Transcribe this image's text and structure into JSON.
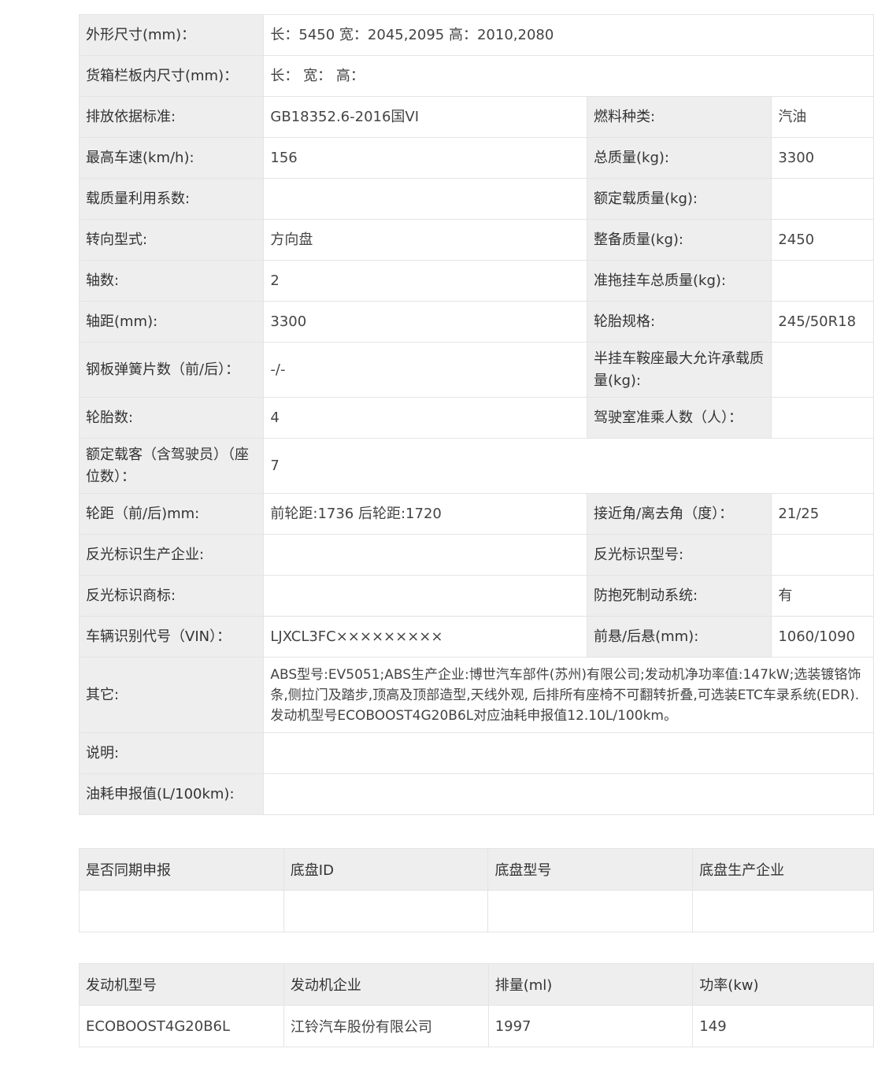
{
  "spec": {
    "dimensions": {
      "label": "外形尺寸(mm)：",
      "value": "长：5450 宽：2045,2095 高：2010,2080"
    },
    "cargo_box": {
      "label": "货箱栏板内尺寸(mm)：",
      "value": "长： 宽： 高："
    },
    "rows": [
      {
        "l1": "排放依据标准:",
        "v1": "GB18352.6-2016国VI",
        "l2": "燃料种类:",
        "v2": "汽油"
      },
      {
        "l1": "最高车速(km/h):",
        "v1": "156",
        "l2": "总质量(kg):",
        "v2": "3300"
      },
      {
        "l1": "载质量利用系数:",
        "v1": "",
        "l2": "额定载质量(kg):",
        "v2": ""
      },
      {
        "l1": "转向型式:",
        "v1": "方向盘",
        "l2": "整备质量(kg):",
        "v2": "2450"
      },
      {
        "l1": "轴数:",
        "v1": "2",
        "l2": "准拖挂车总质量(kg):",
        "v2": ""
      },
      {
        "l1": "轴距(mm):",
        "v1": "3300",
        "l2": "轮胎规格:",
        "v2": "245/50R18"
      },
      {
        "l1": "钢板弹簧片数（前/后）：",
        "v1": "-/-",
        "l2": "半挂车鞍座最大允许承载质量(kg):",
        "v2": ""
      },
      {
        "l1": "轮胎数:",
        "v1": "4",
        "l2": "驾驶室准乘人数（人）：",
        "v2": ""
      }
    ],
    "rated_passengers": {
      "label": "额定载客（含驾驶员）（座位数）：",
      "value": "7"
    },
    "rows2": [
      {
        "l1": "轮距（前/后)mm:",
        "v1": "前轮距:1736 后轮距:1720",
        "l2": "接近角/离去角（度）：",
        "v2": "21/25"
      },
      {
        "l1": "反光标识生产企业:",
        "v1": "",
        "l2": "反光标识型号:",
        "v2": ""
      },
      {
        "l1": "反光标识商标:",
        "v1": "",
        "l2": "防抱死制动系统:",
        "v2": "有"
      },
      {
        "l1": "车辆识别代号（VIN）：",
        "v1": "LJXCL3FC×××××××××",
        "l2": "前悬/后悬(mm):",
        "v2": "1060/1090"
      }
    ],
    "other": {
      "label": "其它:",
      "value": "ABS型号:EV5051;ABS生产企业:博世汽车部件(苏州)有限公司;发动机净功率值:147kW;选装镀铬饰条,侧拉门及踏步,顶高及顶部造型,天线外观, 后排所有座椅不可翻转折叠,可选装ETC车录系统(EDR).发动机型号ECOBOOST4G20B6L对应油耗申报值12.10L/100km。"
    },
    "note": {
      "label": "说明:",
      "value": ""
    },
    "fuel": {
      "label": "油耗申报值(L/100km):",
      "value": ""
    }
  },
  "chassis": {
    "headers": [
      "是否同期申报",
      "底盘ID",
      "底盘型号",
      "底盘生产企业"
    ],
    "cells": [
      "",
      "",
      "",
      ""
    ]
  },
  "engine": {
    "headers": [
      "发动机型号",
      "发动机企业",
      "排量(ml)",
      "功率(kw)"
    ],
    "cells": [
      "ECOBOOST4G20B6L",
      "江铃汽车股份有限公司",
      "1997",
      "149"
    ]
  }
}
